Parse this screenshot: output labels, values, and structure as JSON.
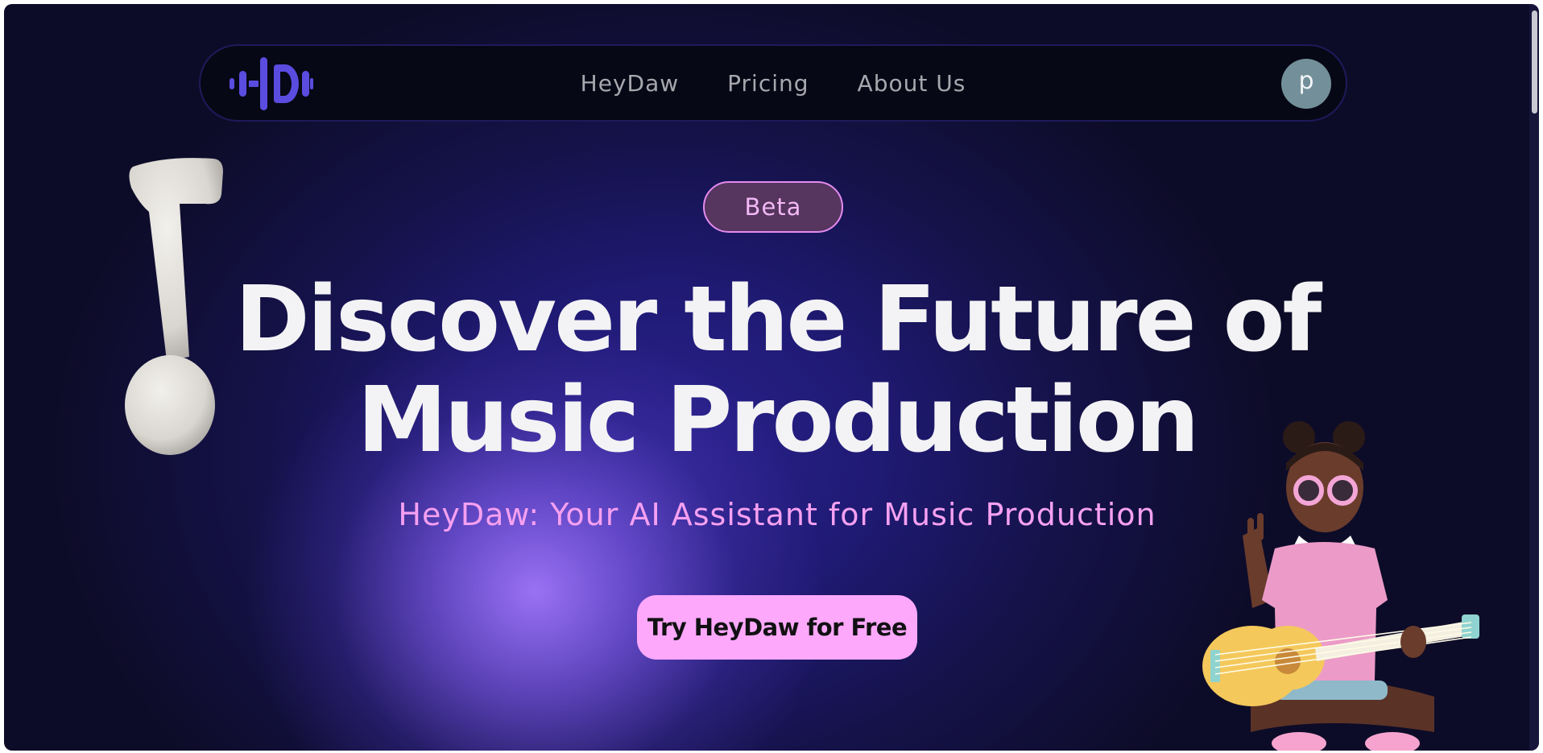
{
  "nav": {
    "items": [
      {
        "label": "HeyDaw"
      },
      {
        "label": "Pricing"
      },
      {
        "label": "About Us"
      }
    ],
    "avatar_letter": "p"
  },
  "hero": {
    "badge": "Beta",
    "title_line1": "Discover the Future of",
    "title_line2": "Music Production",
    "subtitle": "HeyDaw: Your AI Assistant for Music Production",
    "cta_label": "Try HeyDaw for Free"
  },
  "icons": {
    "logo": "heydaw-logo-icon",
    "note": "music-note-icon",
    "character": "guitar-character-illustration"
  },
  "colors": {
    "accent_pink": "#fea8fb",
    "subtitle_pink": "#f6a0f1",
    "logo_purple": "#5b4ce0",
    "nav_bg": "#070815",
    "page_bg": "#15124a"
  }
}
